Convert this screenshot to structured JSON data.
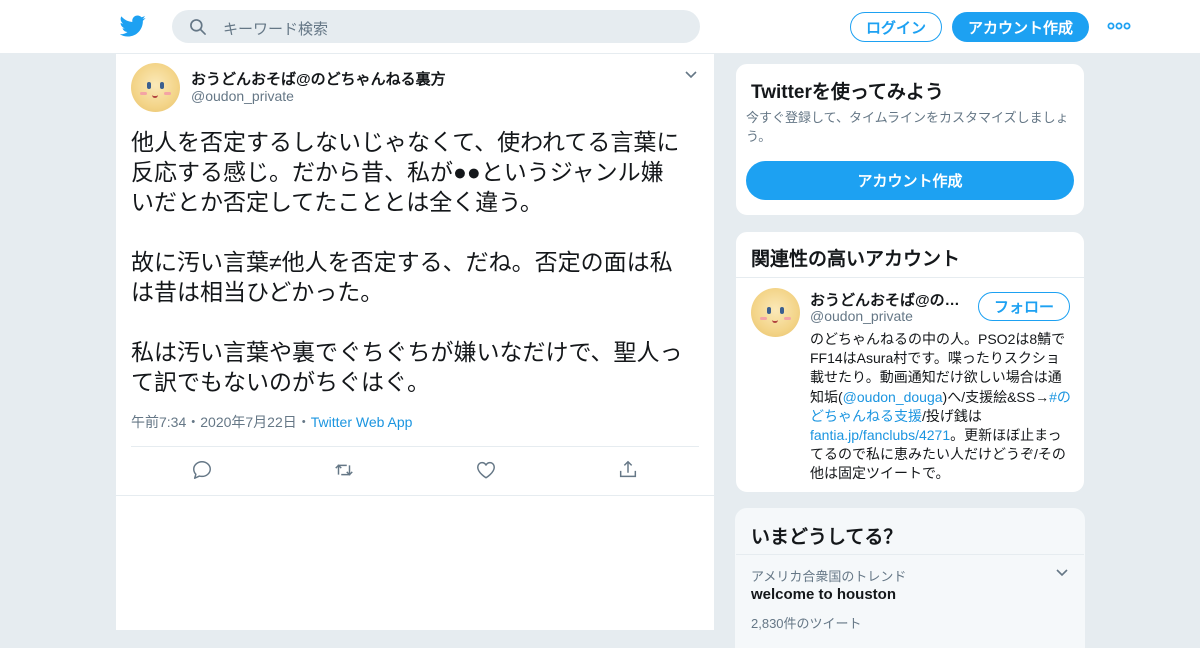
{
  "header": {
    "search_placeholder": "キーワード検索",
    "login_label": "ログイン",
    "signup_label": "アカウント作成"
  },
  "tweet": {
    "author_name": "おうどんおそば@のどちゃんねる裏方",
    "author_handle": "@oudon_private",
    "text": "他人を否定するしないじゃなくて、使われてる言葉に\n反応する感じ。だから昔、私が●●というジャンル嫌\nいだとか否定してたこととは全く違う。\n\n故に汚い言葉≠他人を否定する、だね。否定の面は私\nは昔は相当ひどかった。\n\n私は汚い言葉や裏でぐちぐちが嫌いなだけで、聖人っ\nて訳でもないのがちぐはぐ。",
    "time": "午前7:34",
    "date": "2020年7月22日",
    "sep": "・",
    "app": "Twitter Web App"
  },
  "sidebar": {
    "try_card": {
      "title": "Twitterを使ってみよう",
      "description": "今すぐ登録して、タイムラインをカスタマイズしましょう。",
      "button": "アカウント作成"
    },
    "related_card": {
      "title": "関連性の高いアカウント",
      "name": "おうどんおそば@の…",
      "handle": "@oudon_private",
      "follow_label": "フォロー",
      "bio": {
        "p1": "のどちゃんねるの中の人。PSO2は8鯖でFF14はAsura村です。喋ったりスクショ載せたり。動画通知だけ欲しい場合は通知垢(",
        "link1": "@oudon_douga",
        "p2": ")へ/支援絵&SS→",
        "link2": "#のどちゃんねる支援",
        "p3": "/投げ銭は",
        "link3": "fantia.jp/fanclubs/4271",
        "p4": "。更新ほぼ止まってるので私に恵みたい人だけどうぞ/その他は固定ツイートで。"
      }
    },
    "trends_card": {
      "title": "いまどうしてる？",
      "context": "アメリカ合衆国のトレンド",
      "name": "welcome to houston",
      "count": "2,830件のツイート"
    }
  },
  "colors": {
    "accent": "#1da1f2",
    "link": "#1b95e0",
    "secondary_text": "#657786",
    "background": "#e6ecf0"
  },
  "icons": [
    "twitter-bird-icon",
    "search-icon",
    "more-dots-icon",
    "chevron-down-icon",
    "reply-icon",
    "retweet-icon",
    "like-icon",
    "share-icon"
  ]
}
